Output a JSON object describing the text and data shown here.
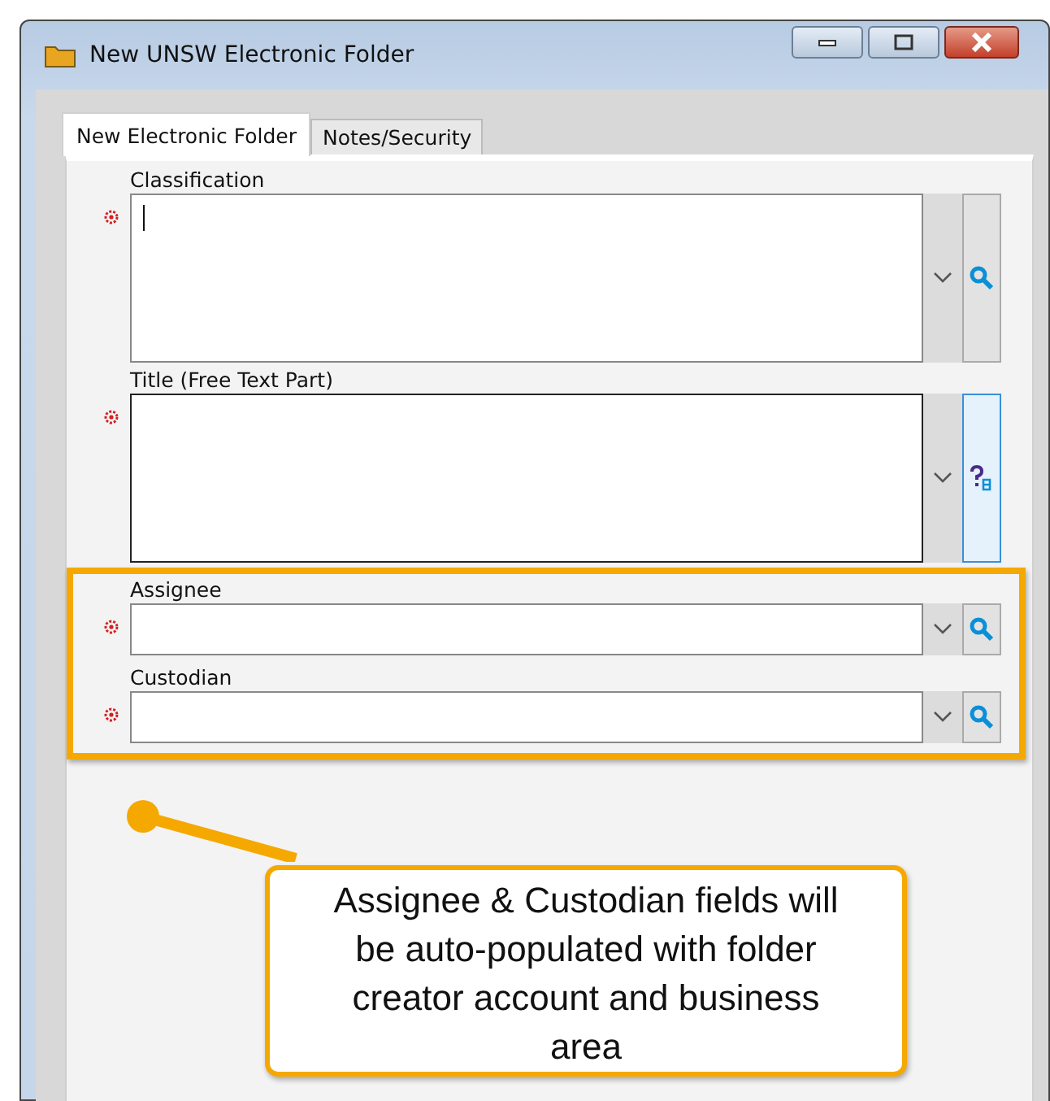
{
  "window": {
    "title": "New UNSW Electronic Folder"
  },
  "tabs": [
    {
      "label": "New Electronic Folder",
      "selected": true
    },
    {
      "label": "Notes/Security",
      "selected": false
    }
  ],
  "fields": [
    {
      "label": "Classification",
      "required": true,
      "multiline": true,
      "focused": true,
      "lookup": {
        "kind": "search",
        "selected": false
      },
      "highlighted": false
    },
    {
      "label": "Title (Free Text Part)",
      "required": true,
      "multiline": true,
      "focused": false,
      "lookup": {
        "kind": "help",
        "selected": true
      },
      "highlighted": false
    },
    {
      "label": "Assignee",
      "required": true,
      "multiline": false,
      "focused": false,
      "lookup": {
        "kind": "search",
        "selected": false
      },
      "highlighted": true
    },
    {
      "label": "Custodian",
      "required": true,
      "multiline": false,
      "focused": false,
      "lookup": {
        "kind": "search",
        "selected": false
      },
      "highlighted": true
    }
  ],
  "callout": {
    "text": "Assignee & Custodian fields will be auto-populated with folder creator account and business area"
  }
}
